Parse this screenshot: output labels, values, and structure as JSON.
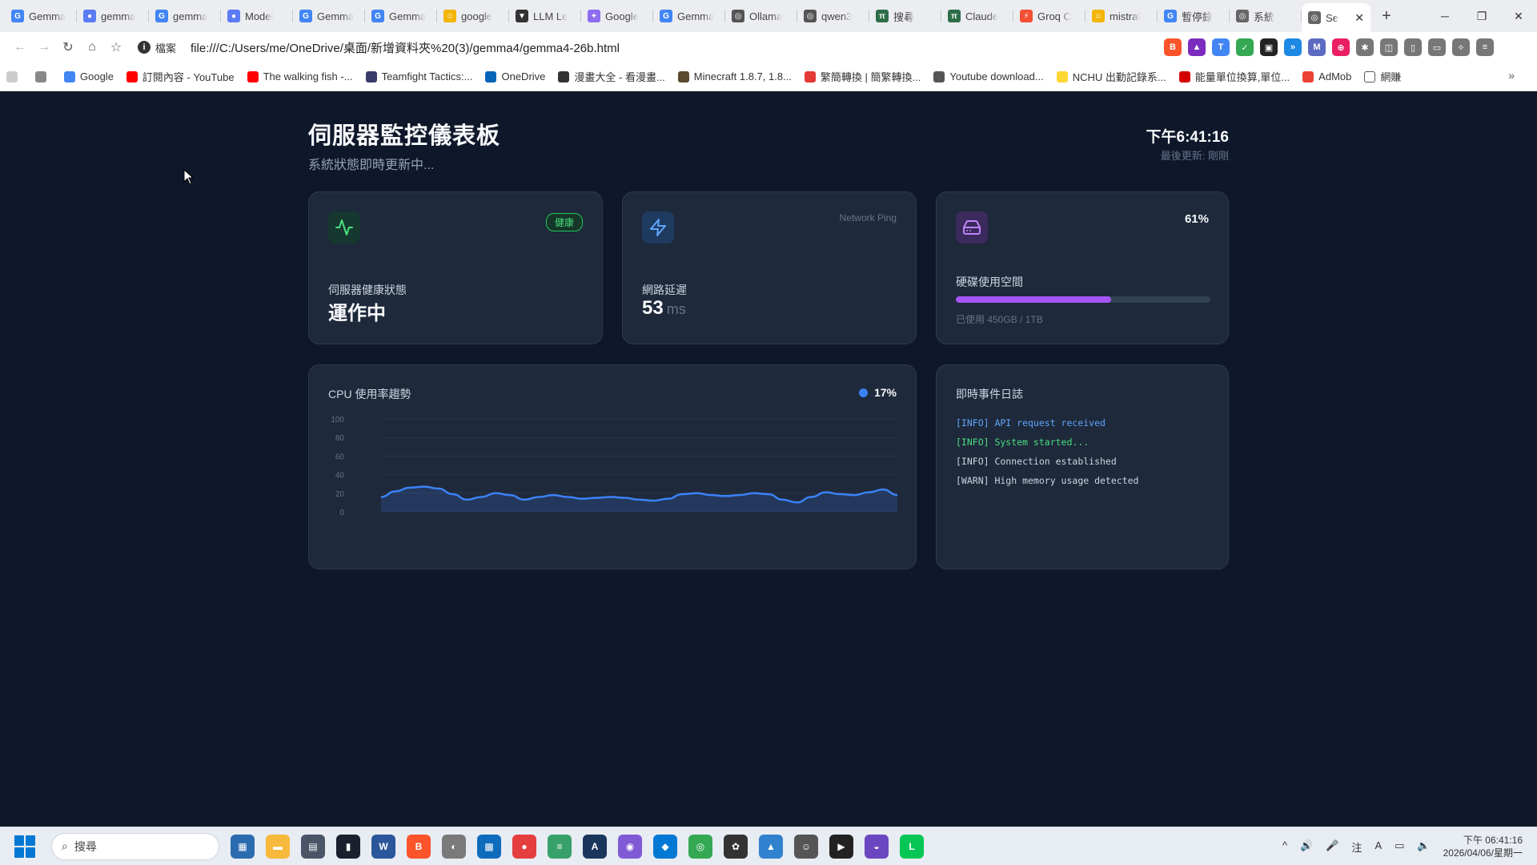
{
  "browser": {
    "tabs": [
      {
        "title": "Gemma",
        "fav": "G",
        "color": "#4285f4"
      },
      {
        "title": "gemma",
        "fav": "●",
        "color": "#5b7cf5"
      },
      {
        "title": "gemma",
        "fav": "G",
        "color": "#4285f4"
      },
      {
        "title": "Model",
        "fav": "●",
        "color": "#5b7cf5"
      },
      {
        "title": "Gemma",
        "fav": "G",
        "color": "#4285f4"
      },
      {
        "title": "Gemma",
        "fav": "G",
        "color": "#4285f4"
      },
      {
        "title": "google",
        "fav": "☺",
        "color": "#f4b400"
      },
      {
        "title": "LLM Le",
        "fav": "▼",
        "color": "#333333"
      },
      {
        "title": "Google",
        "fav": "✦",
        "color": "#8e6cf0"
      },
      {
        "title": "Gemma",
        "fav": "G",
        "color": "#4285f4"
      },
      {
        "title": "Ollama",
        "fav": "◎",
        "color": "#555555"
      },
      {
        "title": "qwen3",
        "fav": "◎",
        "color": "#555555"
      },
      {
        "title": "搜尋",
        "fav": "π",
        "color": "#2c6e49"
      },
      {
        "title": "Claude",
        "fav": "π",
        "color": "#2c6e49"
      },
      {
        "title": "Groq C",
        "fav": "⚡",
        "color": "#f55036"
      },
      {
        "title": "mistral",
        "fav": "☺",
        "color": "#f4b400"
      },
      {
        "title": "暫停錄",
        "fav": "G",
        "color": "#4285f4"
      },
      {
        "title": "系統",
        "fav": "◎",
        "color": "#666666"
      }
    ],
    "active_tab": {
      "title": "Se",
      "fav": "◎"
    },
    "new_tab": "+",
    "window_controls": {
      "minimize": "─",
      "restore": "❐",
      "close": "✕"
    },
    "nav": {
      "back": "←",
      "forward": "→",
      "reload": "↻",
      "home": "⌂",
      "bookmark": "☆"
    },
    "url_scheme_label": "檔案",
    "url": "file:///C:/Users/me/OneDrive/桌面/新增資料夾%20(3)/gemma4/gemma4-26b.html",
    "extensions": [
      {
        "label": "B",
        "color": "#fb542b"
      },
      {
        "label": "▲",
        "color": "#7b2cbf"
      },
      {
        "label": "T",
        "color": "#4285f4"
      },
      {
        "label": "✓",
        "color": "#34a853"
      },
      {
        "label": "▣",
        "color": "#222222"
      },
      {
        "label": "»",
        "color": "#1e88e5"
      },
      {
        "label": "M",
        "color": "#5c6bc0"
      },
      {
        "label": "⊕",
        "color": "#e91e63"
      },
      {
        "label": "✱",
        "color": "#777777"
      },
      {
        "label": "◫",
        "color": "#777777"
      },
      {
        "label": "▯",
        "color": "#777777"
      },
      {
        "label": "▭",
        "color": "#777777"
      },
      {
        "label": "✧",
        "color": "#777777"
      },
      {
        "label": "≡",
        "color": "#777777"
      }
    ],
    "bookmarks": [
      {
        "label": "",
        "color": "#cccccc"
      },
      {
        "label": "",
        "color": "#888888"
      },
      {
        "label": "Google",
        "color": "#4285f4"
      },
      {
        "label": "訂閱內容 - YouTube",
        "color": "#ff0000"
      },
      {
        "label": "The walking fish -...",
        "color": "#ff0000"
      },
      {
        "label": "Teamfight Tactics:...",
        "color": "#3b3b6d"
      },
      {
        "label": "OneDrive",
        "color": "#0364b8"
      },
      {
        "label": "漫畫大全 - 看漫畫...",
        "color": "#333333"
      },
      {
        "label": "Minecraft 1.8.7, 1.8...",
        "color": "#5b4a2f"
      },
      {
        "label": "繁簡轉換 | 簡繁轉換...",
        "color": "#e53935"
      },
      {
        "label": "Youtube download...",
        "color": "#555555"
      },
      {
        "label": "NCHU 出勤記錄系...",
        "color": "#fdd835"
      },
      {
        "label": "能量單位換算,單位...",
        "color": "#d50000"
      },
      {
        "label": "AdMob",
        "color": "#ea4335"
      },
      {
        "label": "網賺",
        "color": "#ffffff"
      }
    ],
    "bookmarks_more": "»"
  },
  "dashboard": {
    "title": "伺服器監控儀表板",
    "subtitle": "系統狀態即時更新中...",
    "clock": "下午6:41:16",
    "last_update": "最後更新: 剛剛",
    "health": {
      "badge": "健康",
      "label": "伺服器健康狀態",
      "value": "運作中"
    },
    "network": {
      "tag": "Network Ping",
      "label": "網路延遲",
      "value": "53",
      "unit": "ms"
    },
    "disk": {
      "percent_label": "61%",
      "label": "硬碟使用空間",
      "fill_fraction": 0.61,
      "note": "已使用 450GB / 1TB"
    },
    "cpu": {
      "title": "CPU 使用率趨勢",
      "current": "17%"
    },
    "log": {
      "title": "即時事件日誌",
      "entries": [
        {
          "text": "[INFO] API request received",
          "level": "blue"
        },
        {
          "text": "[INFO] System started...",
          "level": "green"
        },
        {
          "text": "[INFO] Connection established",
          "level": "gray"
        },
        {
          "text": "[WARN] High memory usage detected",
          "level": "gray"
        }
      ]
    },
    "colors": {
      "bg": "#0f172a",
      "card": "#1e293b",
      "accent_blue": "#3b82f6",
      "accent_green": "#22c55e",
      "accent_purple": "#a855f7"
    }
  },
  "chart_data": {
    "type": "area",
    "title": "CPU 使用率趨勢",
    "xlabel": "",
    "ylabel": "",
    "ylim": [
      0,
      100
    ],
    "yticks": [
      0,
      20,
      40,
      60,
      80,
      100
    ],
    "grid": true,
    "series": [
      {
        "values": [
          16,
          22,
          26,
          27,
          25,
          19,
          13,
          16,
          20,
          18,
          13,
          16,
          18,
          16,
          14,
          15,
          16,
          15,
          13,
          12,
          14,
          19,
          20,
          18,
          17,
          18,
          20,
          19,
          13,
          10,
          16,
          21,
          19,
          18,
          21,
          24,
          18
        ]
      }
    ]
  },
  "taskbar": {
    "search_placeholder": "搜尋",
    "apps": [
      {
        "label": "▦",
        "color": "#2b6cb0"
      },
      {
        "label": "▬",
        "color": "#f6b93b"
      },
      {
        "label": "▤",
        "color": "#4a5568"
      },
      {
        "label": "▮",
        "color": "#1a202c"
      },
      {
        "label": "W",
        "color": "#2b579a"
      },
      {
        "label": "B",
        "color": "#fb542b"
      },
      {
        "label": "◐",
        "color": "#7a7a7a"
      },
      {
        "label": "▩",
        "color": "#0f6cbd"
      },
      {
        "label": "●",
        "color": "#e53e3e"
      },
      {
        "label": "≡",
        "color": "#38a169"
      },
      {
        "label": "A",
        "color": "#1a365d"
      },
      {
        "label": "◉",
        "color": "#805ad5"
      },
      {
        "label": "◆",
        "color": "#0078d4"
      },
      {
        "label": "◎",
        "color": "#34a853"
      },
      {
        "label": "✿",
        "color": "#333333"
      },
      {
        "label": "▲",
        "color": "#3182ce"
      },
      {
        "label": "☺",
        "color": "#555555"
      },
      {
        "label": "▶",
        "color": "#222222"
      },
      {
        "label": "◒",
        "color": "#6b46c1"
      },
      {
        "label": "L",
        "color": "#06c755"
      }
    ],
    "tray_icons": [
      "^",
      "🔊",
      "🎤",
      "注",
      "A",
      "▭",
      "🔈"
    ],
    "time": "下午 06:41:16",
    "date": "2026/04/06/星期一"
  }
}
